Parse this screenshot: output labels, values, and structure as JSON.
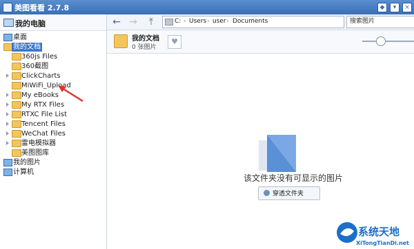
{
  "window": {
    "title": "美图看看 2.7.8"
  },
  "sidebar": {
    "header": "我的电脑",
    "tree": [
      {
        "label": "桌面",
        "kind": "desktop"
      },
      {
        "label": "我的文档",
        "kind": "folder",
        "selected": true
      },
      {
        "label": "360js Files",
        "kind": "folder"
      },
      {
        "label": "360截图",
        "kind": "folder"
      },
      {
        "label": "ClickCharts",
        "kind": "folder"
      },
      {
        "label": "MiWiFi_Upload",
        "kind": "folder"
      },
      {
        "label": "My eBooks",
        "kind": "folder"
      },
      {
        "label": "My RTX Files",
        "kind": "folder"
      },
      {
        "label": "RTXC File List",
        "kind": "folder"
      },
      {
        "label": "Tencent Files",
        "kind": "folder"
      },
      {
        "label": "WeChat Files",
        "kind": "folder"
      },
      {
        "label": "雷电模拟器",
        "kind": "folder"
      },
      {
        "label": "美图图库",
        "kind": "folder"
      },
      {
        "label": "我的图片",
        "kind": "desktop"
      },
      {
        "label": "计算机",
        "kind": "desktop"
      }
    ]
  },
  "toolbar": {
    "path": [
      "C:",
      "Users",
      "user",
      "Documents"
    ],
    "search_placeholder": "搜索图片"
  },
  "folder_info": {
    "name": "我的文档",
    "count": "0 张图片"
  },
  "content": {
    "empty_message": "该文件夹没有可显示的图片",
    "browse_label": "穿透文件夹"
  },
  "watermark": {
    "title": "系统天地",
    "url": "XiTongTianDi.net"
  },
  "colors": {
    "accent": "#3a78c9",
    "titlebar": "#3a6fb8",
    "arrow": "#e0322c"
  }
}
